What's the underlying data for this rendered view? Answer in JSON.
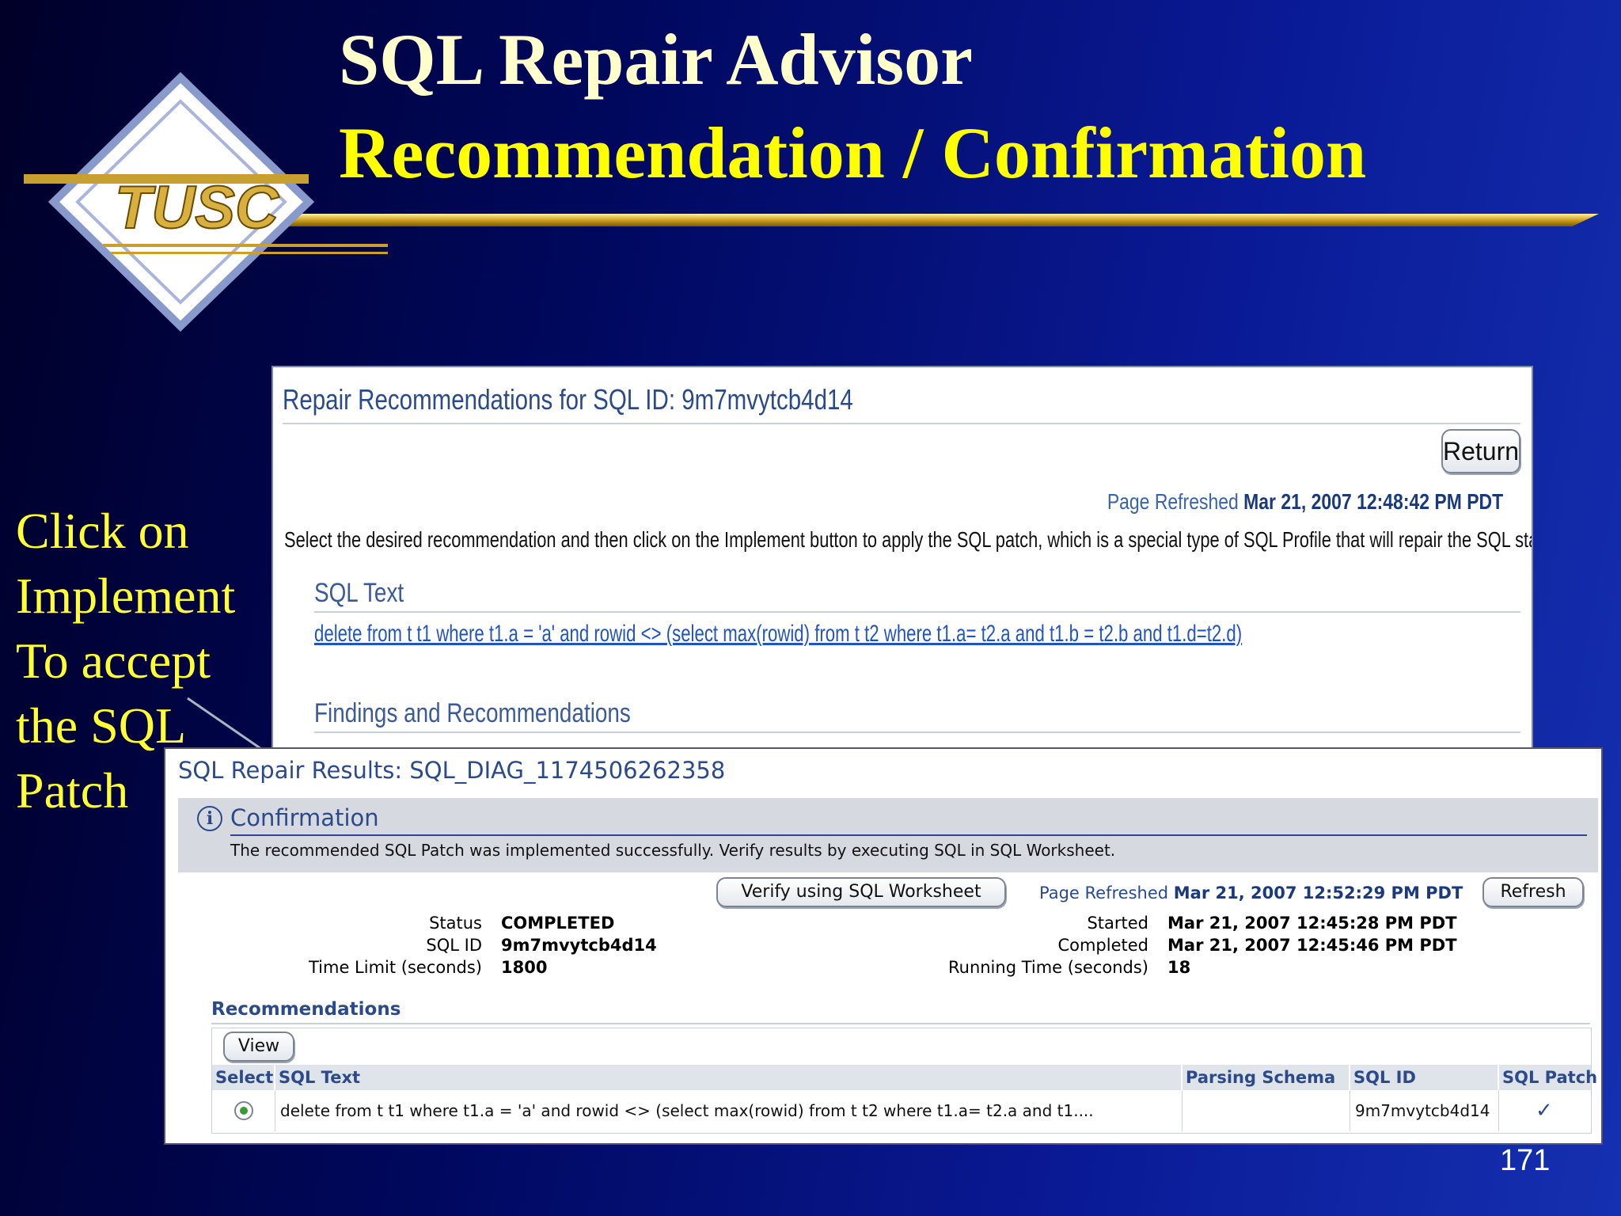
{
  "slide": {
    "title_line1": "SQL Repair Advisor",
    "title_line2": "Recommendation / Confirmation",
    "logo_text": "TUSC",
    "side_note_lines": [
      "Click on",
      "Implement",
      "To accept",
      "the SQL",
      "Patch"
    ],
    "page_number": "171"
  },
  "repair_page": {
    "title": "Repair Recommendations for SQL ID: 9m7mvytcb4d14",
    "return_label": "Return",
    "page_refreshed_label": "Page Refreshed",
    "page_refreshed_value": "Mar 21, 2007 12:48:42 PM PDT",
    "instruction": "Select the desired recommendation and then click on the Implement button to apply the SQL patch, which is a special type of SQL Profile that will repair the SQL statement.",
    "sql_text_heading": "SQL Text",
    "sql_text": "delete from t t1 where t1.a = 'a' and rowid <> (select max(rowid) from t t2 where t1.a= t2.a and t1.b = t2.b and t1.d=t2.d)",
    "findings_heading": "Findings and Recommendations"
  },
  "results_page": {
    "title": "SQL Repair Results: SQL_DIAG_1174506262358",
    "confirmation": {
      "title": "Confirmation",
      "message": "The recommended SQL Patch was implemented successfully. Verify results by executing SQL in SQL Worksheet."
    },
    "verify_label": "Verify using SQL Worksheet",
    "page_refreshed_label": "Page Refreshed",
    "page_refreshed_value": "Mar 21, 2007 12:52:29 PM PDT",
    "refresh_label": "Refresh",
    "left_details": [
      {
        "label": "Status",
        "value": "COMPLETED"
      },
      {
        "label": "SQL ID",
        "value": "9m7mvytcb4d14"
      },
      {
        "label": "Time Limit (seconds)",
        "value": "1800"
      }
    ],
    "right_details": [
      {
        "label": "Started",
        "value": "Mar 21, 2007 12:45:28 PM PDT"
      },
      {
        "label": "Completed",
        "value": "Mar 21, 2007 12:45:46 PM PDT"
      },
      {
        "label": "Running Time (seconds)",
        "value": "18"
      }
    ],
    "recommendations": {
      "heading": "Recommendations",
      "view_label": "View",
      "columns": [
        "Select",
        "SQL Text",
        "Parsing Schema",
        "SQL ID",
        "SQL Patch"
      ],
      "rows": [
        {
          "sql_text": "delete from t t1 where t1.a = 'a' and rowid <> (select max(rowid) from t t2 where t1.a= t2.a and t1....",
          "parsing_schema": "",
          "sql_id": "9m7mvytcb4d14",
          "sql_patch": "✓"
        }
      ]
    }
  }
}
